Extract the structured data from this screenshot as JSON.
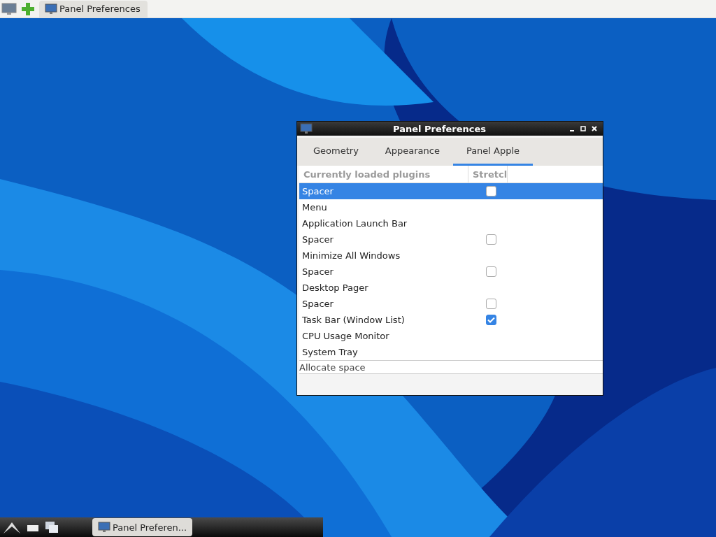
{
  "top_panel": {
    "tasks": [
      {
        "label": "Panel Preferences",
        "selected": true
      }
    ]
  },
  "window": {
    "title": "Panel Preferences",
    "tabs": [
      {
        "label": "Geometry",
        "selected": false
      },
      {
        "label": "Appearance",
        "selected": false
      },
      {
        "label": "Panel Apple",
        "selected": true
      }
    ],
    "table": {
      "columns": [
        "Currently loaded plugins",
        "Stretcl"
      ],
      "rows": [
        {
          "name": "Spacer",
          "stretch": false,
          "selected": true
        },
        {
          "name": "Menu",
          "selected": false
        },
        {
          "name": "Application Launch Bar",
          "selected": false
        },
        {
          "name": "Spacer",
          "stretch": false,
          "selected": false
        },
        {
          "name": "Minimize All Windows",
          "selected": false
        },
        {
          "name": "Spacer",
          "stretch": false,
          "selected": false
        },
        {
          "name": "Desktop Pager",
          "selected": false
        },
        {
          "name": "Spacer",
          "stretch": false,
          "selected": false
        },
        {
          "name": "Task Bar (Window List)",
          "stretch": true,
          "selected": false
        },
        {
          "name": "CPU Usage Monitor",
          "selected": false
        },
        {
          "name": "System Tray",
          "selected": false
        }
      ]
    },
    "status": "Allocate space"
  },
  "taskbar": {
    "tasks": [
      {
        "label": "Panel Preferen...",
        "selected": true
      }
    ]
  }
}
